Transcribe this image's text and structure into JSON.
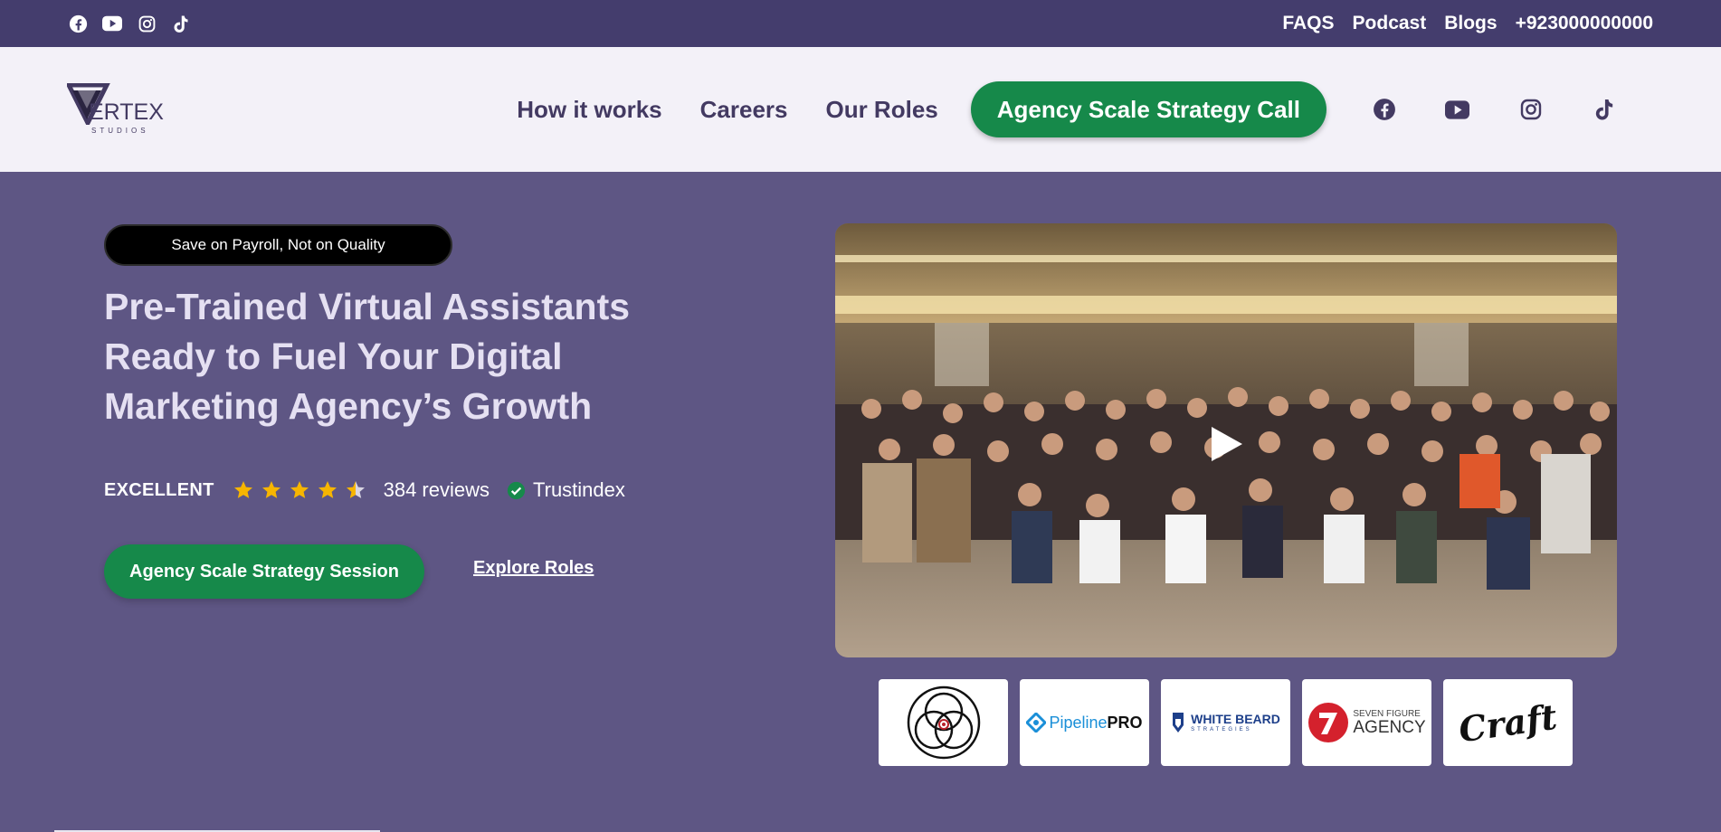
{
  "topbar": {
    "social_icons": [
      "facebook-icon",
      "youtube-icon",
      "instagram-icon",
      "tiktok-icon"
    ],
    "links": [
      "FAQS",
      "Podcast",
      "Blogs",
      "+923000000000"
    ]
  },
  "header": {
    "logo": {
      "word": "ERTEX",
      "sub": "STUDIOS"
    },
    "nav": [
      "How it works",
      "Careers",
      "Our Roles"
    ],
    "cta": "Agency Scale Strategy Call",
    "social_icons": [
      "facebook-icon",
      "youtube-icon",
      "instagram-icon",
      "tiktok-icon"
    ]
  },
  "hero": {
    "badge": "Save on Payroll, Not on Quality",
    "title": "Pre-Trained Virtual Assistants Ready to Fuel Your Digital Marketing Agency’s Growth",
    "rating": {
      "label": "EXCELLENT",
      "stars": 4.5,
      "reviews": "384 reviews",
      "provider": "Trustindex"
    },
    "primary_button": "Agency Scale Strategy Session",
    "secondary_link": "Explore Roles"
  },
  "media": {
    "video_poster": "team-group-photo",
    "play_icon": "play-icon"
  },
  "clients": {
    "pipeline": {
      "a": "Pipeline",
      "b": "PRO"
    },
    "whitebeard": {
      "a": "WHITE BEARD",
      "b": "STRATEGIES"
    },
    "sevenfigure": {
      "a": "SEVEN FIGURE",
      "b": "AGENCY"
    },
    "craft": "Craft"
  },
  "colors": {
    "topbar": "#443d6d",
    "header": "#f3f1f8",
    "hero": "#5e5684",
    "accent_green": "#16894a",
    "star": "#f7b500"
  }
}
